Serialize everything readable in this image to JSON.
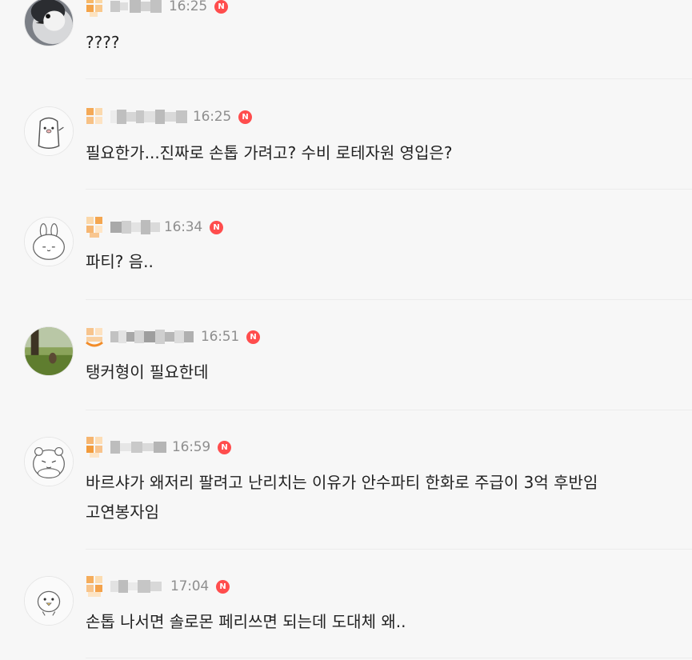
{
  "comments": [
    {
      "time": "16:25",
      "badge": "N",
      "text": "????",
      "avatar": "penguin-photo-icon"
    },
    {
      "time": "16:25",
      "badge": "N",
      "text": "필요한가...진짜로 손톱 가려고? 수비 로테자원 영입은?",
      "avatar": "cartoon-character-icon"
    },
    {
      "time": "16:34",
      "badge": "N",
      "text": "파티? 음..",
      "avatar": "bunny-character-icon"
    },
    {
      "time": "16:51",
      "badge": "N",
      "text": "탱커형이 필요한데",
      "avatar": "landscape-photo-icon"
    },
    {
      "time": "16:59",
      "badge": "N",
      "text": "바르샤가 왜저리 팔려고 난리치는 이유가 안수파티 한화로 주급이 3억 후반임",
      "text2": "고연봉자임",
      "avatar": "hamster-character-icon"
    },
    {
      "time": "17:04",
      "badge": "N",
      "text": "손톱 나서면 솔로몬 페리쓰면 되는데 도대체 왜..",
      "avatar": "chick-character-icon"
    }
  ],
  "colors": {
    "badge": "#ff4d4d",
    "time": "#8e8e8e",
    "background": "#f7f7f7",
    "divider": "#ececec"
  }
}
